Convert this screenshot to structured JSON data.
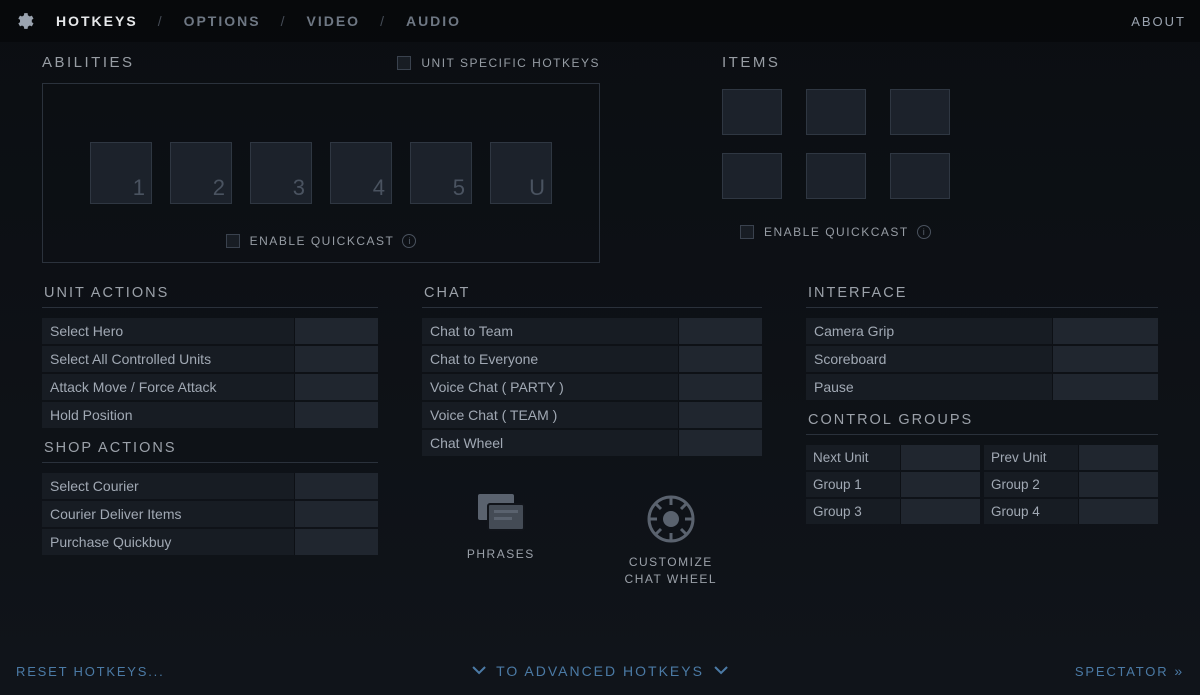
{
  "tabs": {
    "hotkeys": "HOTKEYS",
    "options": "OPTIONS",
    "video": "VIDEO",
    "audio": "AUDIO"
  },
  "about": "ABOUT",
  "abilities": {
    "title": "ABILITIES",
    "unitSpecific": "UNIT SPECIFIC HOTKEYS",
    "slots": [
      "1",
      "2",
      "3",
      "4",
      "5",
      "U"
    ],
    "quickcast": "ENABLE QUICKCAST"
  },
  "items": {
    "title": "ITEMS",
    "quickcast": "ENABLE QUICKCAST"
  },
  "unitActions": {
    "title": "UNIT ACTIONS",
    "rows": [
      "Select Hero",
      "Select All Controlled Units",
      "Attack Move / Force Attack",
      "Hold Position"
    ]
  },
  "shopActions": {
    "title": "SHOP ACTIONS",
    "rows": [
      "Select Courier",
      "Courier Deliver Items",
      "Purchase Quickbuy"
    ]
  },
  "chat": {
    "title": "CHAT",
    "rows": [
      "Chat to Team",
      "Chat to Everyone",
      "Voice Chat ( PARTY )",
      "Voice Chat ( TEAM )",
      "Chat Wheel"
    ],
    "phrases": "PHRASES",
    "customize": "CUSTOMIZE\nCHAT WHEEL"
  },
  "interface": {
    "title": "INTERFACE",
    "rows": [
      "Camera Grip",
      "Scoreboard",
      "Pause"
    ]
  },
  "controlGroups": {
    "title": "CONTROL GROUPS",
    "rows": [
      [
        "Next Unit",
        "Prev Unit"
      ],
      [
        "Group 1",
        "Group 2"
      ],
      [
        "Group 3",
        "Group 4"
      ]
    ]
  },
  "footer": {
    "reset": "RESET HOTKEYS...",
    "advanced": "TO ADVANCED HOTKEYS",
    "spectator": "SPECTATOR"
  }
}
